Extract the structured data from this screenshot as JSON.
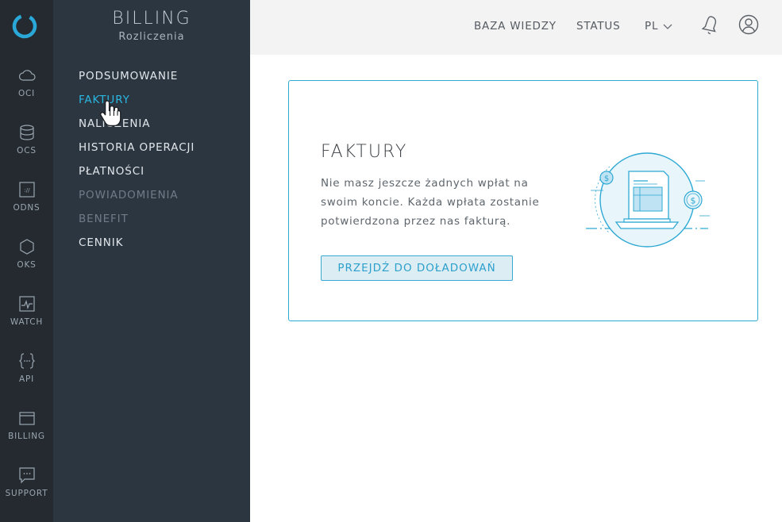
{
  "rail": {
    "items": [
      {
        "label": "OCI",
        "icon": "cloud-icon"
      },
      {
        "label": "OCS",
        "icon": "database-icon"
      },
      {
        "label": "ODNS",
        "icon": "dns-icon"
      },
      {
        "label": "OKS",
        "icon": "hexagon-icon"
      },
      {
        "label": "WATCH",
        "icon": "monitor-icon"
      },
      {
        "label": "API",
        "icon": "braces-icon"
      },
      {
        "label": "BILLING",
        "icon": "wallet-icon"
      },
      {
        "label": "SUPPORT",
        "icon": "chat-icon"
      }
    ]
  },
  "sidebar": {
    "title": "BILLING",
    "subtitle": "Rozliczenia",
    "items": [
      {
        "label": "PODSUMOWANIE"
      },
      {
        "label": "FAKTURY"
      },
      {
        "label": "NALICZENIA"
      },
      {
        "label": "HISTORIA OPERACJI"
      },
      {
        "label": "PŁATNOŚCI"
      },
      {
        "label": "POWIADOMIENIA"
      },
      {
        "label": "BENEFIT"
      },
      {
        "label": "CENNIK"
      }
    ]
  },
  "topbar": {
    "knowledge_base": "BAZA WIEDZY",
    "status": "STATUS",
    "language": "PL"
  },
  "card": {
    "title": "FAKTURY",
    "text": "Nie masz jeszcze żadnych wpłat na swoim koncie. Każda wpłata zostanie potwierdzona przez nas fakturą.",
    "button": "PRZEJDŹ DO DOŁADOWAŃ"
  },
  "colors": {
    "accent": "#29b6e0",
    "rail_bg": "#242a30",
    "sidebar_bg": "#2c3641",
    "topbar_bg": "#f3f3f3"
  }
}
